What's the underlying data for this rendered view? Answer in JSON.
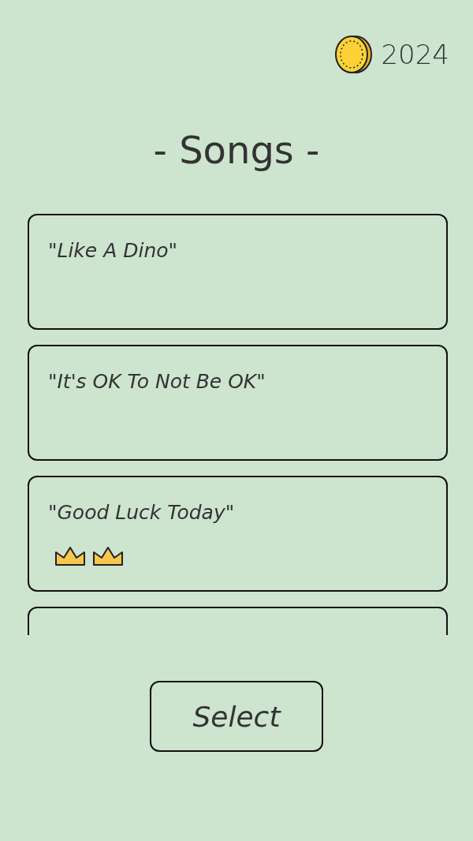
{
  "coins": "2024",
  "title": "- Songs -",
  "songs": [
    {
      "title": "\"Like A Dino\""
    },
    {
      "title": "\"It's OK To Not Be OK\""
    },
    {
      "title": "\"Good Luck Today\"",
      "badges": [
        {
          "kind": "crown"
        },
        {
          "kind": "crown"
        }
      ]
    }
  ],
  "more_songs_below": true,
  "button": "Select"
}
